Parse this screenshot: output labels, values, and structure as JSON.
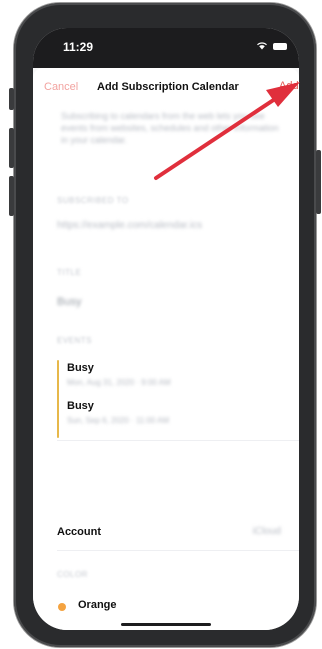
{
  "status": {
    "time": "11:29"
  },
  "nav": {
    "cancel": "Cancel",
    "title": "Add Subscription Calendar",
    "add": "Add"
  },
  "description": "Subscribing to calendars from the web lets you see events from websites, schedules and other information in your calendar.",
  "subscribed_to": {
    "header": "SUBSCRIBED TO",
    "value": "https://example.com/calendar.ics"
  },
  "title_section": {
    "header": "TITLE",
    "value": "Busy"
  },
  "events": {
    "header": "EVENTS",
    "items": [
      {
        "title": "Busy",
        "time": "Mon, Aug 31, 2020 · 9:00 AM"
      },
      {
        "title": "Busy",
        "time": "Sun, Sep 6, 2020 · 11:00 AM"
      }
    ]
  },
  "account": {
    "label": "Account",
    "value": "iCloud"
  },
  "color": {
    "header": "COLOR",
    "label": "Orange"
  },
  "colors": {
    "accent": "#e55a55",
    "event_bar": "#e7b84a",
    "color_dot": "#f4a340",
    "arrow": "#e02f3c"
  }
}
